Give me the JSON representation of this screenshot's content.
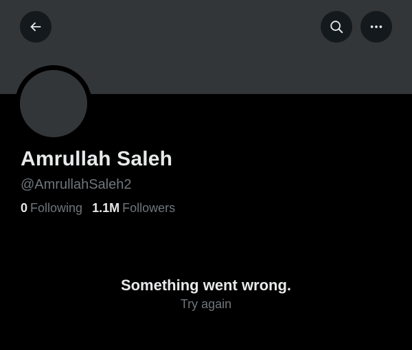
{
  "header": {
    "icons": {
      "back": "arrow-left-icon",
      "search": "search-icon",
      "more": "more-horizontal-icon"
    },
    "banner_color": "#333639"
  },
  "profile": {
    "display_name": "Amrullah Saleh",
    "handle": "@AmrullahSaleh2",
    "following_count": "0",
    "following_label": "Following",
    "followers_count": "1.1M",
    "followers_label": "Followers"
  },
  "error": {
    "title": "Something went wrong.",
    "retry_label": "Try again"
  },
  "colors": {
    "background": "#000000",
    "primary_text": "#e7e9ea",
    "secondary_text": "#71767b"
  }
}
